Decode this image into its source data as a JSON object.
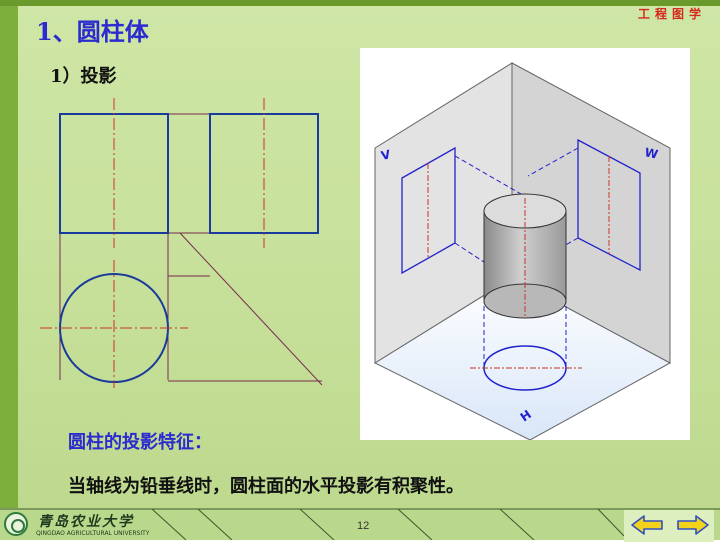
{
  "header": {
    "brand": "工程图学"
  },
  "slide": {
    "title": "1、圆柱体",
    "subtitle": "1）投影",
    "feature_label": "圆柱的投影特征：",
    "feature_text": "当轴线为铅垂线时，圆柱面的水平投影有积聚性。"
  },
  "diagram": {
    "labels": {
      "v": "V",
      "w": "W",
      "h": "H"
    },
    "colors": {
      "outline": "#1a3a9c",
      "centerline": "#cc3322",
      "construction": "#7a2a50",
      "iso_line": "#2222cc"
    }
  },
  "footer": {
    "university_cn": "青岛农业大学",
    "university_en": "QINGDAO AGRICULTURAL UNIVERSITY",
    "page_number": "12",
    "nav": {
      "prev_icon": "arrow-left-icon",
      "next_icon": "arrow-right-icon"
    }
  }
}
